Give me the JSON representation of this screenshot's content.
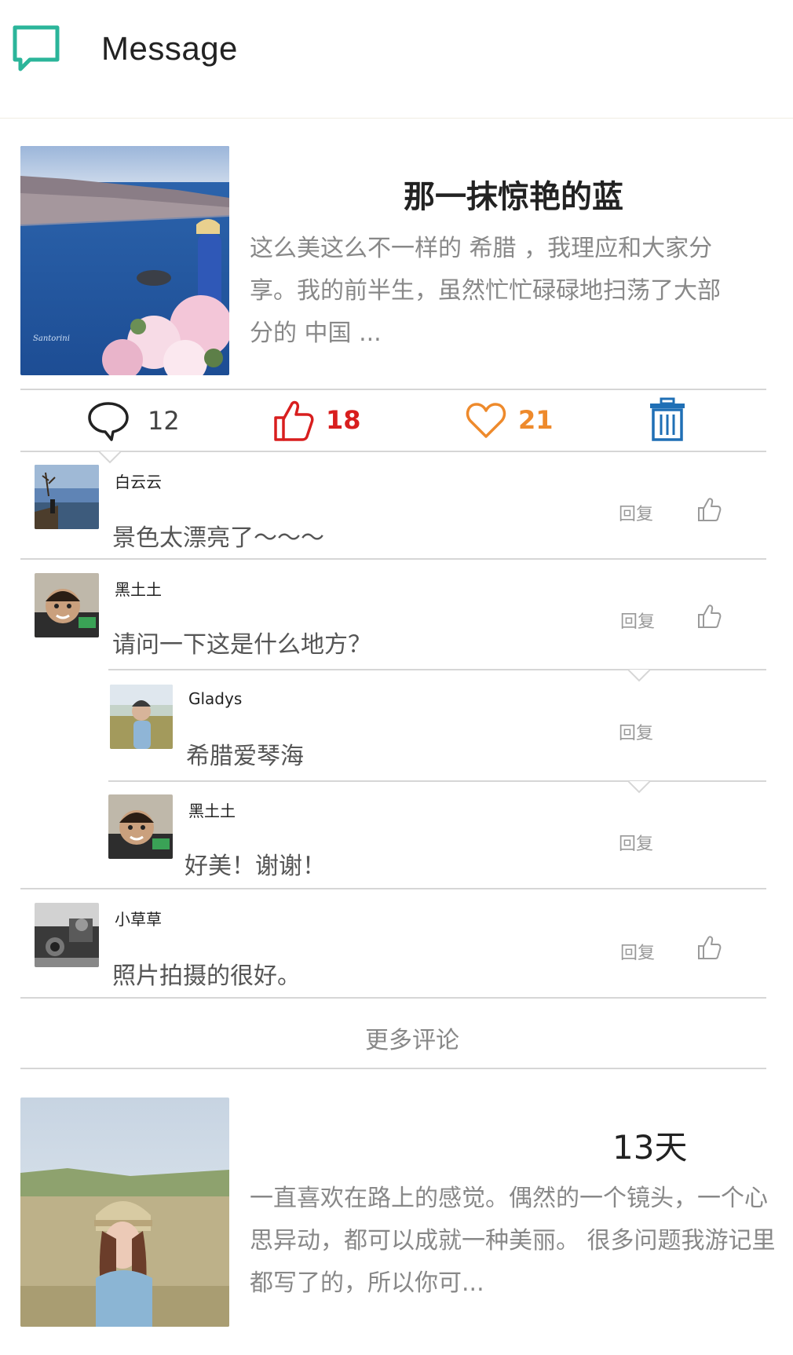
{
  "header": {
    "title": "Message",
    "icon": "chat-bubble-icon",
    "accent": "#2bb59a"
  },
  "post1": {
    "title": "那一抹惊艳的蓝",
    "excerpt": "这么美这么不一样的 希腊 ，我理应和大家分享。我的前半生，虽然忙忙碌碌地扫荡了大部分的 中国 ...",
    "image_caption": "Santorini",
    "actions": {
      "comments": "12",
      "likes": "18",
      "favorites": "21"
    },
    "colors": {
      "like": "#d81e1e",
      "favorite": "#ee8a2c",
      "trash": "#1f6fb5"
    }
  },
  "comments": [
    {
      "name": "白云云",
      "text": "景色太漂亮了～～～",
      "reply": "回复"
    },
    {
      "name": "黑土土",
      "text": "请问一下这是什么地方？",
      "reply": "回复",
      "replies": [
        {
          "name": "Gladys",
          "text": "希腊爱琴海",
          "reply": "回复"
        },
        {
          "name": "黑土土",
          "text": "好美！谢谢！",
          "reply": "回复"
        }
      ]
    },
    {
      "name": "小草草",
      "text": "照片拍摄的很好。",
      "reply": "回复"
    }
  ],
  "more_comments": "更多评论",
  "post2": {
    "days": "13天",
    "excerpt": "一直喜欢在路上的感觉。偶然的一个镜头，一个心思异动，都可以成就一种美丽。 很多问题我游记里都写了的，所以你可..."
  }
}
